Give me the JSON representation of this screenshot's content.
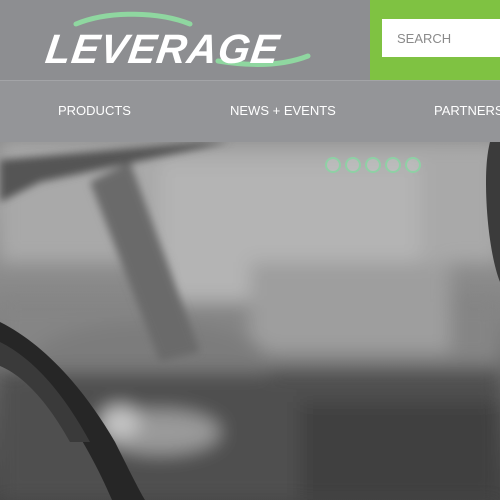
{
  "brand": {
    "logo_text": "LEVERAGE",
    "colors": {
      "accent": "#7fc242",
      "header": "#8d8e91",
      "nav": "#949598"
    }
  },
  "search": {
    "placeholder": "SEARCH",
    "value": ""
  },
  "nav": {
    "items": [
      {
        "label": "PRODUCTS"
      },
      {
        "label": "NEWS + EVENTS"
      },
      {
        "label": "PARTNERS"
      }
    ]
  },
  "carousel": {
    "slide_count": 5,
    "current_slide": 1,
    "hero_image": "car-interior-photo"
  }
}
